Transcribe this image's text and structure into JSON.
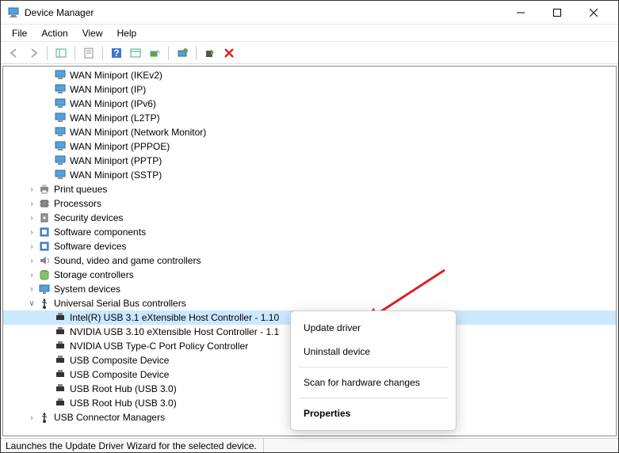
{
  "window": {
    "title": "Device Manager"
  },
  "menu": {
    "file": "File",
    "action": "Action",
    "view": "View",
    "help": "Help"
  },
  "tree": {
    "wan_items": [
      "WAN Miniport (IKEv2)",
      "WAN Miniport (IP)",
      "WAN Miniport (IPv6)",
      "WAN Miniport (L2TP)",
      "WAN Miniport (Network Monitor)",
      "WAN Miniport (PPPOE)",
      "WAN Miniport (PPTP)",
      "WAN Miniport (SSTP)"
    ],
    "categories": [
      {
        "label": "Print queues",
        "icon": "printer"
      },
      {
        "label": "Processors",
        "icon": "cpu"
      },
      {
        "label": "Security devices",
        "icon": "security"
      },
      {
        "label": "Software components",
        "icon": "software"
      },
      {
        "label": "Software devices",
        "icon": "software"
      },
      {
        "label": "Sound, video and game controllers",
        "icon": "sound"
      },
      {
        "label": "Storage controllers",
        "icon": "storage"
      },
      {
        "label": "System devices",
        "icon": "system"
      }
    ],
    "usb_category": "Universal Serial Bus controllers",
    "usb_items": [
      "Intel(R) USB 3.1 eXtensible Host Controller - 1.10",
      "NVIDIA USB 3.10 eXtensible Host Controller - 1.1",
      "NVIDIA USB Type-C Port Policy Controller",
      "USB Composite Device",
      "USB Composite Device",
      "USB Root Hub (USB 3.0)",
      "USB Root Hub (USB 3.0)"
    ],
    "usb_connector": "USB Connector Managers"
  },
  "context_menu": {
    "update": "Update driver",
    "uninstall": "Uninstall device",
    "scan": "Scan for hardware changes",
    "properties": "Properties"
  },
  "status": "Launches the Update Driver Wizard for the selected device."
}
